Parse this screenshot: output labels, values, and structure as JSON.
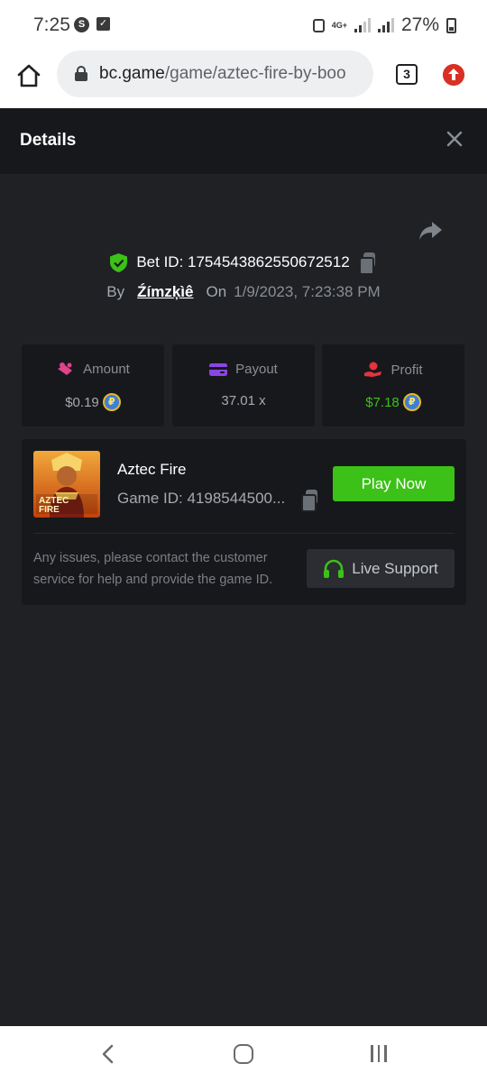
{
  "status_bar": {
    "time": "7:25",
    "network": "4G+",
    "battery": "27%"
  },
  "browser": {
    "url_host": "bc.game",
    "url_path": "/game/aztec-fire-by-boo",
    "tab_count": "3"
  },
  "modal": {
    "title": "Details"
  },
  "bet": {
    "id_label": "Bet ID: 1754543862550672512",
    "by_label": "By",
    "user": "Źímzķìê",
    "on_label": "On",
    "datetime": "1/9/2023, 7:23:38 PM"
  },
  "stats": [
    {
      "label": "Amount",
      "value": "$0.19",
      "icon": "amount-icon",
      "color": "#e0448a"
    },
    {
      "label": "Payout",
      "value": "37.01 x",
      "icon": "wallet-icon",
      "color": "#8a45e6"
    },
    {
      "label": "Profit",
      "value": "$7.18",
      "icon": "profit-icon",
      "color": "#e3343f"
    }
  ],
  "game": {
    "name": "Aztec Fire",
    "game_id": "Game ID: 4198544500...",
    "thumb_text_1": "AZTEC",
    "thumb_text_2": "FIRE",
    "play_label": "Play Now",
    "issue_text": "Any issues, please contact the customer service for help and provide the game ID.",
    "support_label": "Live Support"
  },
  "colors": {
    "accent_green": "#3bc117",
    "panel": "#17181b",
    "background": "#1f2125"
  }
}
